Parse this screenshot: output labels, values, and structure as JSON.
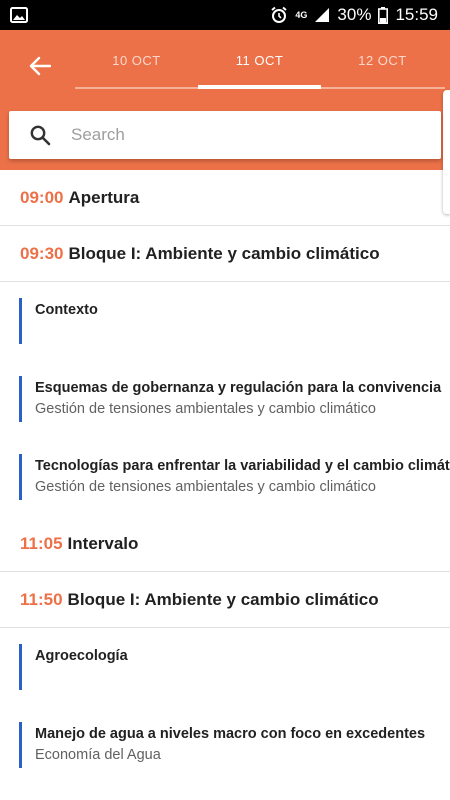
{
  "statusbar": {
    "network": "4G",
    "battery": "30%",
    "time": "15:59"
  },
  "header": {
    "tabs": [
      {
        "label": "10 OCT"
      },
      {
        "label": "11 OCT"
      },
      {
        "label": "12 OCT"
      }
    ],
    "active_tab": 1
  },
  "search": {
    "placeholder": "Search",
    "value": ""
  },
  "schedule": {
    "blocks": [
      {
        "time": "09:00",
        "title": "Apertura"
      },
      {
        "time": "09:30",
        "title": "Bloque I: Ambiente y cambio climático"
      },
      {
        "time": "11:05",
        "title": "Intervalo"
      },
      {
        "time": "11:50",
        "title": "Bloque I: Ambiente y cambio climático"
      }
    ],
    "sessions": [
      {
        "title": "Contexto",
        "subtitle": ""
      },
      {
        "title": "Esquemas de gobernanza y regulación para la convivencia",
        "subtitle": "Gestión de tensiones ambientales y cambio climático"
      },
      {
        "title": "Tecnologías para enfrentar la variabilidad y el cambio climático",
        "subtitle": "Gestión de tensiones ambientales y cambio climático"
      },
      {
        "title": "Agroecología",
        "subtitle": ""
      },
      {
        "title": "Manejo de agua a niveles macro con foco en excedentes",
        "subtitle": "Economía del Agua"
      }
    ]
  },
  "colors": {
    "accent": "#ed7148",
    "session_bar": "#2962c4"
  }
}
